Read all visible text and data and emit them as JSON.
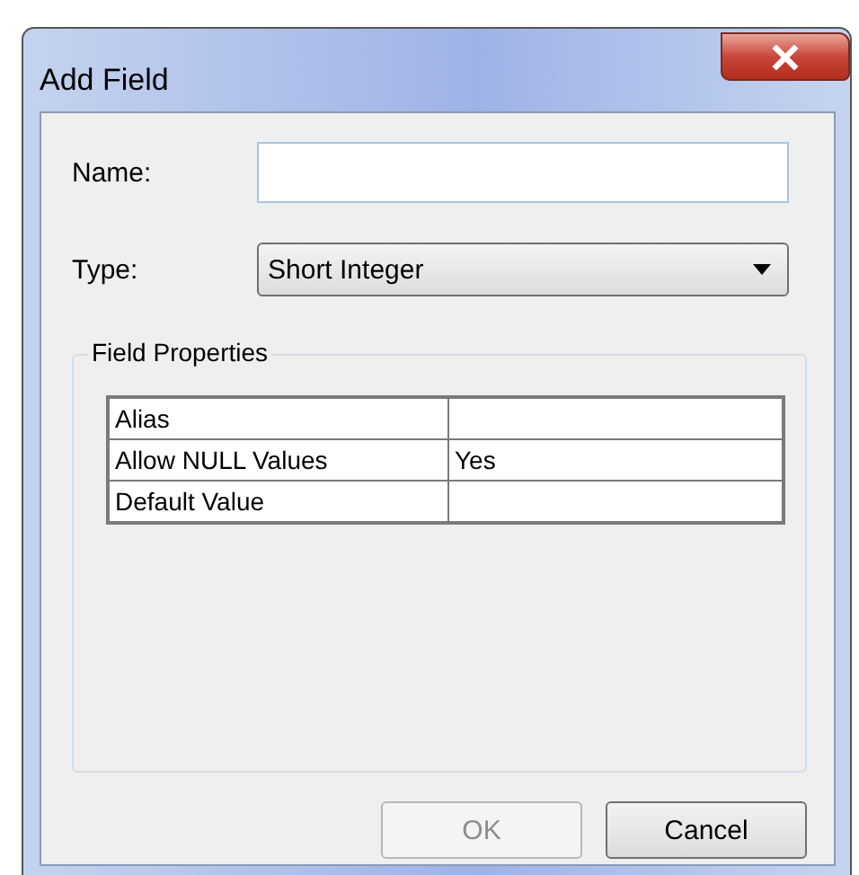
{
  "window": {
    "title": "Add Field"
  },
  "name_field": {
    "label": "Name:"
  },
  "type_field": {
    "label": "Type:",
    "value": "Short Integer"
  },
  "field_properties": {
    "title": "Field Properties",
    "rows": [
      {
        "property": "Alias"
      },
      {
        "property": "Allow NULL Values",
        "value": "Yes"
      },
      {
        "property": "Default Value"
      }
    ]
  },
  "buttons": [
    {
      "label": "OK",
      "disabled": true
    },
    {
      "label": "Cancel",
      "disabled": false
    }
  ]
}
